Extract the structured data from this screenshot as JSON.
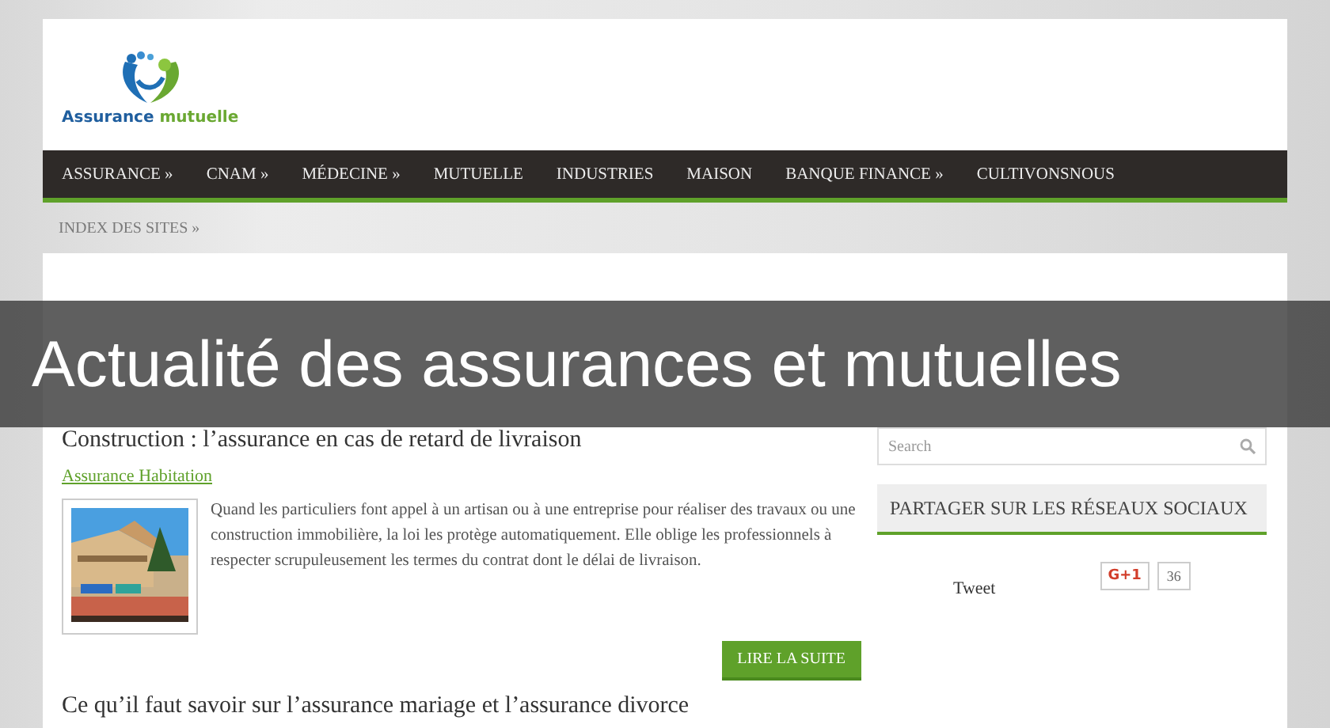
{
  "logo": {
    "text_primary": "Assurance",
    "text_secondary": "mutuelle"
  },
  "nav": {
    "items": [
      {
        "label": "ASSURANCE »"
      },
      {
        "label": "CNAM »"
      },
      {
        "label": "MÉDECINE »"
      },
      {
        "label": "MUTUELLE"
      },
      {
        "label": "INDUSTRIES"
      },
      {
        "label": "MAISON"
      },
      {
        "label": "BANQUE FINANCE »"
      },
      {
        "label": "CULTIVONSNOUS"
      }
    ],
    "second_row": [
      {
        "label": "INDEX DES SITES »"
      }
    ]
  },
  "banner": {
    "title": "Actualité des assurances et mutuelles"
  },
  "articles": [
    {
      "title": "Construction : l’assurance en cas de retard de livraison",
      "category": "Assurance Habitation",
      "excerpt": "Quand les particuliers font appel à un artisan ou à une entreprise pour réaliser des travaux ou une construction immobilière, la loi les protège automatiquement. Elle oblige les professionnels à respecter scrupuleusement les termes du contrat dont le délai de livraison.",
      "button": "LIRE LA SUITE"
    },
    {
      "title": "Ce qu’il faut savoir sur l’assurance mariage et l’assurance divorce"
    }
  ],
  "sidebar": {
    "search": {
      "placeholder": "Search"
    },
    "widget": {
      "title": "PARTAGER SUR LES RÉSEAUX SOCIAUX",
      "tweet": "Tweet",
      "gplus": "G+1",
      "gplus_count": "36"
    }
  }
}
